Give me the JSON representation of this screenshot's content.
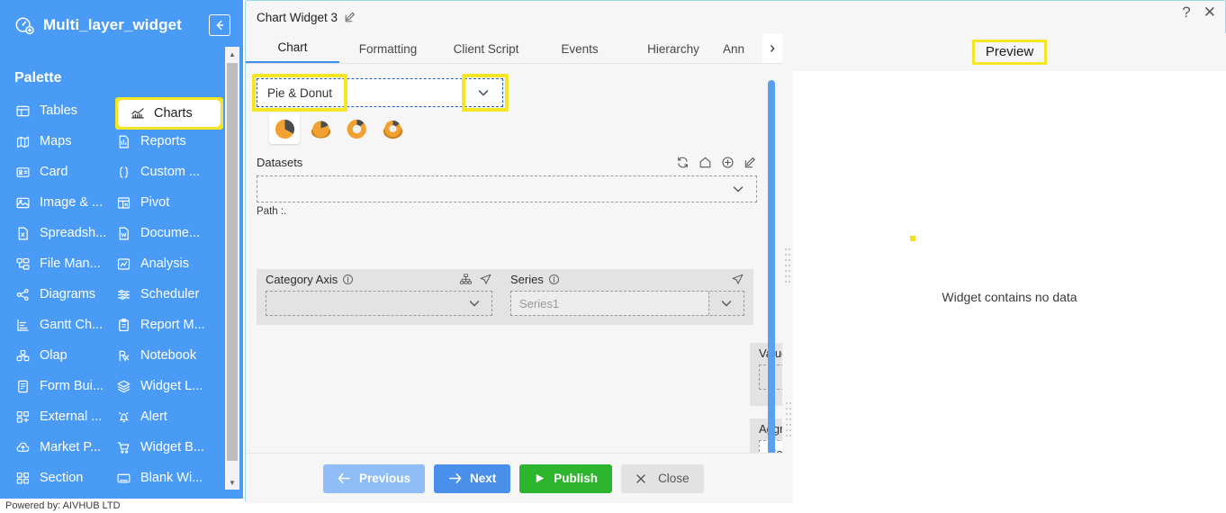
{
  "sidebar": {
    "app_title": "Multi_layer_widget",
    "app_logo_icon": "widget-gauge-icon",
    "collapse_icon": "arrow-left-icon",
    "palette_label": "Palette",
    "items_col1": [
      {
        "label": "Tables",
        "icon": "table-icon"
      },
      {
        "label": "Maps",
        "icon": "map-icon"
      },
      {
        "label": "Card",
        "icon": "id-card-icon"
      },
      {
        "label": "Image & ...",
        "icon": "image-icon"
      },
      {
        "label": "Spreadsh...",
        "icon": "spreadsheet-icon"
      },
      {
        "label": "File Man...",
        "icon": "file-manager-icon"
      },
      {
        "label": "Diagrams",
        "icon": "diagram-icon"
      },
      {
        "label": "Gantt Ch...",
        "icon": "gantt-icon"
      },
      {
        "label": "Olap",
        "icon": "olap-cube-icon"
      },
      {
        "label": "Form Bui...",
        "icon": "form-icon"
      },
      {
        "label": "External ...",
        "icon": "external-app-icon"
      },
      {
        "label": "Market P...",
        "icon": "cloud-upload-icon"
      },
      {
        "label": "Section",
        "icon": "section-grid-icon"
      }
    ],
    "items_col2": [
      {
        "label": "Charts",
        "icon": "chart-icon",
        "selected": true
      },
      {
        "label": "Reports",
        "icon": "report-icon"
      },
      {
        "label": "Custom ...",
        "icon": "curly-braces-icon"
      },
      {
        "label": "Pivot",
        "icon": "pivot-icon"
      },
      {
        "label": "Docume...",
        "icon": "word-document-icon"
      },
      {
        "label": "Analysis",
        "icon": "analysis-icon"
      },
      {
        "label": "Scheduler",
        "icon": "scheduler-sliders-icon"
      },
      {
        "label": "Report M...",
        "icon": "clipboard-icon"
      },
      {
        "label": "Notebook",
        "icon": "notebook-rx-icon"
      },
      {
        "label": "Widget L...",
        "icon": "layers-icon"
      },
      {
        "label": "Alert",
        "icon": "bell-alert-icon"
      },
      {
        "label": "Widget B...",
        "icon": "shopping-cart-icon"
      },
      {
        "label": "Blank Wi...",
        "icon": "blank-window-icon"
      }
    ],
    "scroll_up_icon": "triangle-up-icon",
    "scroll_down_icon": "triangle-down-icon"
  },
  "footer": {
    "powered_by": "Powered by: AIVHUB LTD"
  },
  "window": {
    "title": "Chart Widget 3",
    "edit_icon": "pencil-edit-icon",
    "help_icon": "question-mark-icon",
    "close_icon": "close-x-icon"
  },
  "tabs": [
    {
      "label": "Chart",
      "active": true
    },
    {
      "label": "Formatting",
      "active": false
    },
    {
      "label": "Client Script",
      "active": false
    },
    {
      "label": "Events",
      "active": false
    },
    {
      "label": "Hierarchy",
      "active": false
    },
    {
      "label": "Ann",
      "active": false
    }
  ],
  "tab_next_icon": "chevron-right-icon",
  "chart_type": {
    "selected_value": "Pie & Donut",
    "caret_icon": "chevron-down-icon",
    "variants": [
      {
        "name": "pie-chart-icon",
        "selected": true
      },
      {
        "name": "pie-3d-chart-icon",
        "selected": false
      },
      {
        "name": "donut-chart-icon",
        "selected": false
      },
      {
        "name": "donut-3d-chart-icon",
        "selected": false
      }
    ]
  },
  "datasets": {
    "label": "Datasets",
    "value": "",
    "caret_icon": "chevron-down-icon",
    "path_text": "Path :.",
    "tools": [
      {
        "name": "refresh-icon"
      },
      {
        "name": "home-icon"
      },
      {
        "name": "plus-circle-icon"
      },
      {
        "name": "edit-pencil-icon"
      }
    ]
  },
  "category_axis": {
    "label": "Category Axis",
    "info_icon": "info-icon",
    "hierarchy_icon": "hierarchy-icon",
    "send-icon": "send-arrow-icon",
    "value": "",
    "caret_icon": "chevron-down-icon"
  },
  "series": {
    "label": "Series",
    "info_icon": "info-icon",
    "send_icon": "send-arrow-icon",
    "placeholder": "Series1",
    "value": "",
    "caret_icon": "chevron-down-icon"
  },
  "value_column": {
    "label": "Value Column",
    "value": "",
    "caret_icon": "chevron-down-icon"
  },
  "aggregation": {
    "label": "Aggregation",
    "value": "Count",
    "caret_icon": "chevron-down-icon"
  },
  "buttons": {
    "previous": {
      "label": "Previous",
      "icon": "arrow-left-icon"
    },
    "next": {
      "label": "Next",
      "icon": "arrow-right-icon"
    },
    "publish": {
      "label": "Publish",
      "icon": "play-triangle-icon"
    },
    "close": {
      "label": "Close",
      "icon": "close-x-icon"
    }
  },
  "preview": {
    "title": "Preview",
    "empty_message": "Widget contains no data"
  },
  "colors": {
    "sidebar_blue": "#4a9bf5",
    "highlight_yellow": "#f5e625",
    "accent_blue": "#3d8ef0",
    "publish_green": "#2eb52e",
    "chart_orange": "#f0a130"
  }
}
